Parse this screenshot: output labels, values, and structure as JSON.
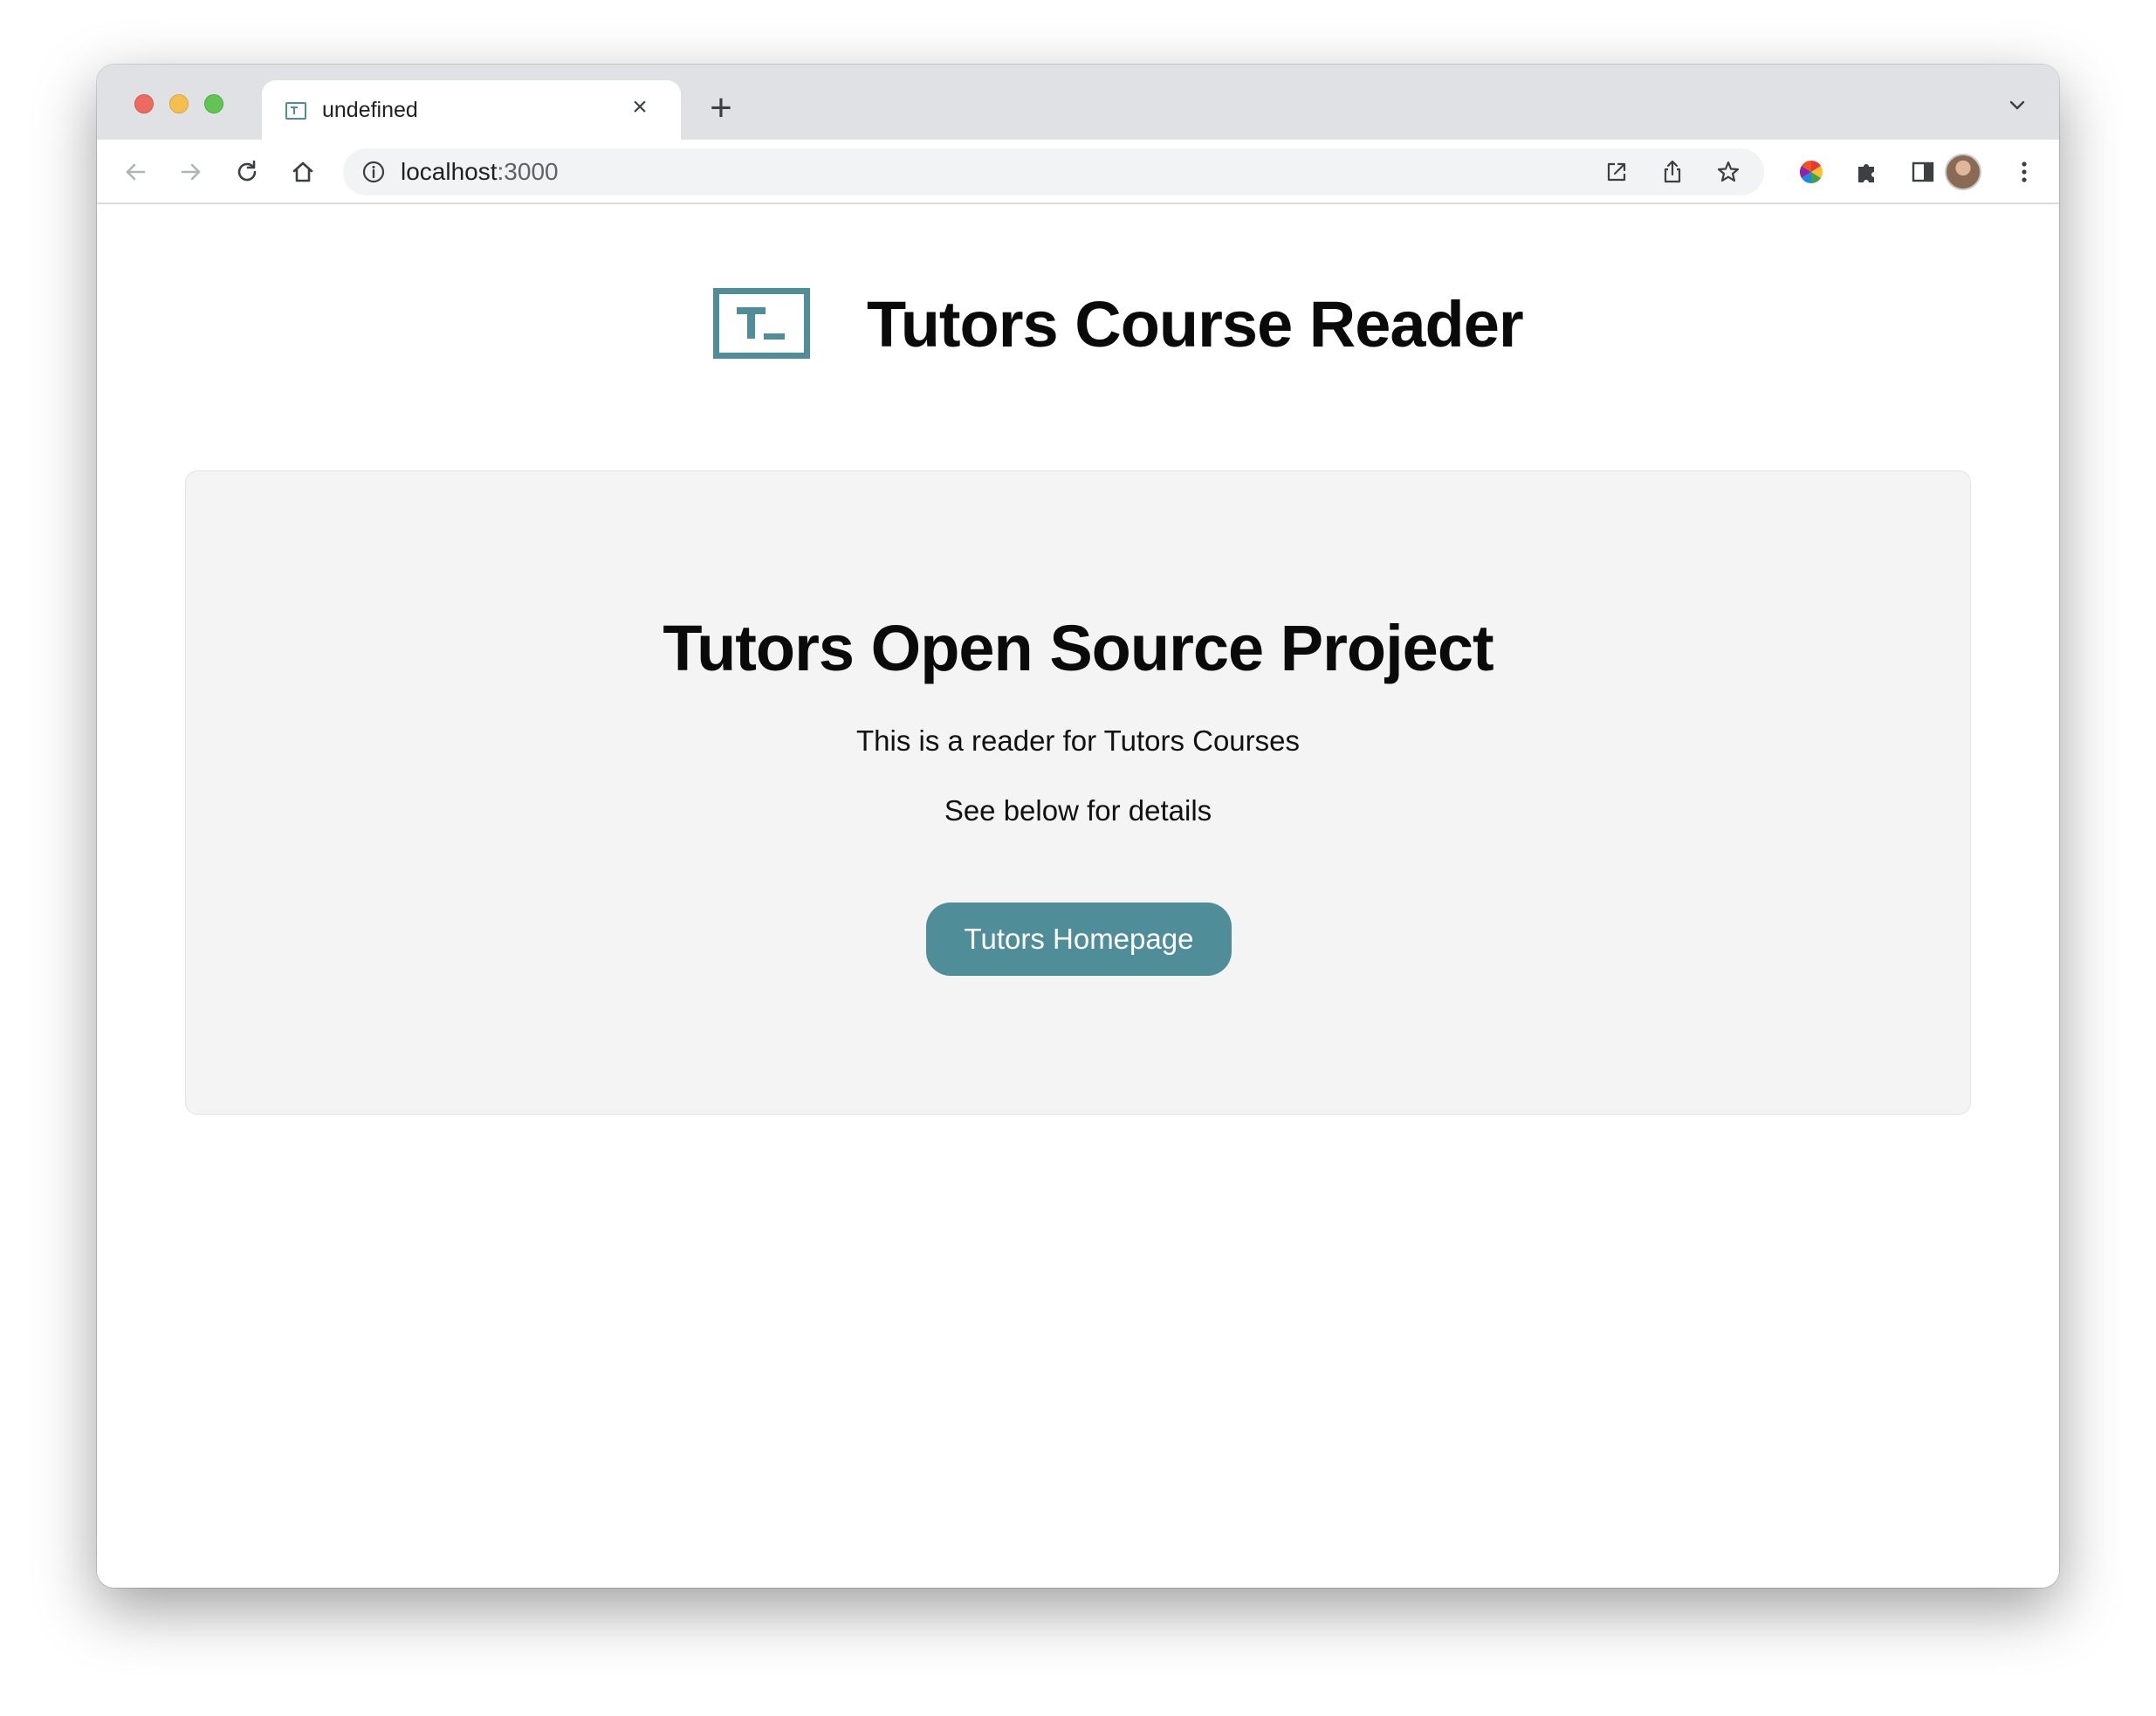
{
  "browser": {
    "tab": {
      "title": "undefined",
      "close_glyph": "×"
    },
    "new_tab_glyph": "+",
    "address": {
      "host": "localhost",
      "port": ":3000"
    },
    "icons": [
      "back-arrow-icon",
      "forward-arrow-icon",
      "reload-icon",
      "home-icon",
      "site-info-icon",
      "open-external-icon",
      "share-icon",
      "bookmark-star-icon",
      "color-extension-icon",
      "extensions-puzzle-icon",
      "side-panel-icon",
      "profile-avatar",
      "more-menu-icon",
      "tab-search-chevron-icon"
    ]
  },
  "page": {
    "header": {
      "title": "Tutors Course Reader"
    },
    "card": {
      "title": "Tutors Open Source Project",
      "line1": "This is a reader for Tutors Courses",
      "line2": "See below for details",
      "button_label": "Tutors Homepage"
    }
  },
  "colors": {
    "accent": "#4f8e99",
    "card_background": "#f4f4f5",
    "tabstrip": "#dfe1e5"
  }
}
